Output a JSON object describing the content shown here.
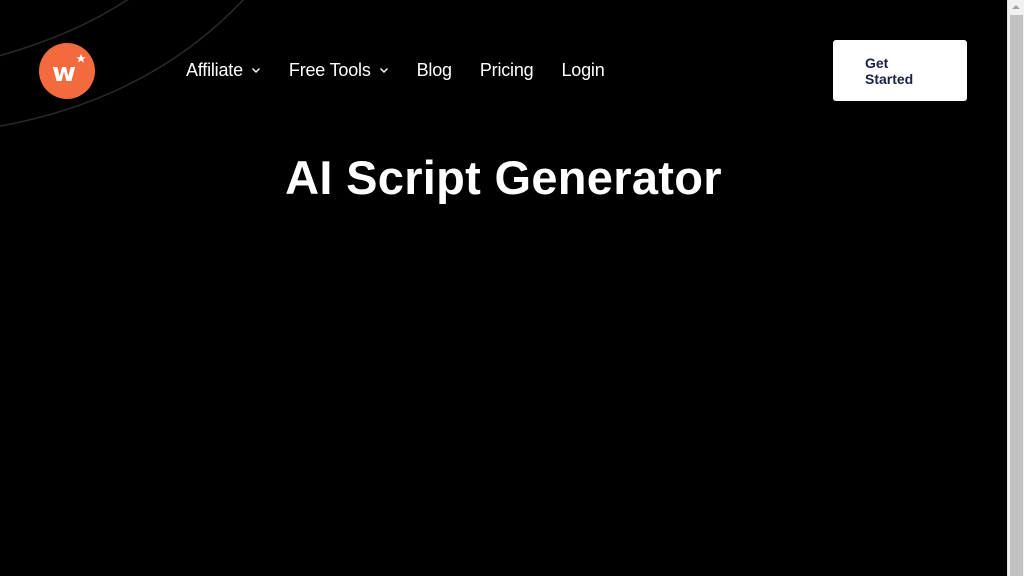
{
  "brand": {
    "logo_letter": "w",
    "logo_color": "#F26A3D"
  },
  "nav": {
    "items": [
      {
        "label": "Affiliate",
        "has_dropdown": true
      },
      {
        "label": "Free Tools",
        "has_dropdown": true
      },
      {
        "label": "Blog",
        "has_dropdown": false
      },
      {
        "label": "Pricing",
        "has_dropdown": false
      },
      {
        "label": "Login",
        "has_dropdown": false
      }
    ]
  },
  "cta": {
    "label": "Get Started",
    "text_color": "#1B1F4B"
  },
  "hero": {
    "title": "AI Script Generator"
  },
  "colors": {
    "background": "#000000",
    "text": "#FFFFFF"
  }
}
